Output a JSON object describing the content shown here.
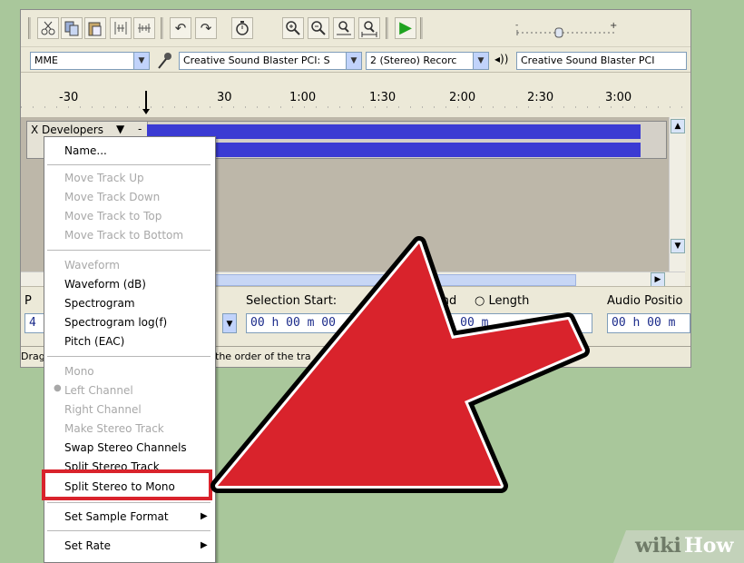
{
  "toolbar": {
    "icons": [
      "scissors-icon",
      "copy-icon",
      "paste-icon",
      "trim-icon",
      "silence-icon",
      "undo-icon",
      "redo-icon",
      "sync-lock-icon",
      "zoom-in-icon",
      "zoom-out-icon",
      "fit-selection-icon",
      "fit-project-icon",
      "play-icon"
    ],
    "undo_glyph": "↶",
    "redo_glyph": "↷",
    "play_glyph": "▶"
  },
  "device": {
    "host": "MME",
    "playback": "Creative Sound Blaster PCI: S",
    "channels": "2 (Stereo) Recorc",
    "recording": "Creative Sound Blaster PCI"
  },
  "timeline": {
    "ticks": [
      "-30",
      "30",
      "1:00",
      "1:30",
      "2:00",
      "2:30",
      "3:00"
    ]
  },
  "track": {
    "close": "X",
    "name": "Developers",
    "arrow": "▼",
    "minus": "-"
  },
  "menu": {
    "name_item": "Name...",
    "move_items": [
      "Move Track Up",
      "Move Track Down",
      "Move Track to Top",
      "Move Track to Bottom"
    ],
    "view_items": [
      {
        "label": "Waveform",
        "disabled": true
      },
      {
        "label": "Waveform (dB)",
        "disabled": false
      },
      {
        "label": "Spectrogram",
        "disabled": false
      },
      {
        "label": "Spectrogram log(f)",
        "disabled": false
      },
      {
        "label": "Pitch (EAC)",
        "disabled": false
      }
    ],
    "channel_items": [
      {
        "label": "Mono",
        "disabled": true
      },
      {
        "label": "Left Channel",
        "disabled": true
      },
      {
        "label": "Right Channel",
        "disabled": true
      },
      {
        "label": "Make Stereo Track",
        "disabled": true
      },
      {
        "label": "Swap Stereo Channels",
        "disabled": false
      },
      {
        "label": "Split Stereo Track",
        "disabled": false
      },
      {
        "label": "Split Stereo to Mono",
        "disabled": false
      }
    ],
    "sample_format": "Set Sample Format",
    "rate": "Set Rate",
    "submenu_glyph": "▶"
  },
  "selection": {
    "project_rate_label": "P",
    "start_label": "Selection Start:",
    "end_label": "End",
    "length_label": "Length",
    "audio_position_label": "Audio Positio",
    "start_value": "00 h 00 m 00",
    "end_value": "00 h 00 m",
    "position_value": "00 h 00 m",
    "rate_value": "4"
  },
  "status": {
    "left": "Drag",
    "right": "the order of the tra"
  },
  "watermark": {
    "part1": "wiki",
    "part2": "How"
  },
  "colors": {
    "wave": "#3b3bd3",
    "arrow": "#d9232c",
    "highlight": "#d9232c"
  }
}
